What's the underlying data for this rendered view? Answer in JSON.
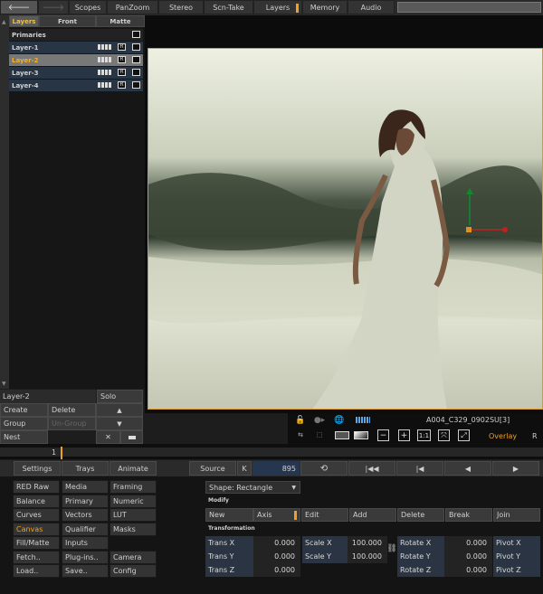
{
  "accent": "#f0a020",
  "topbar": {
    "back_icon": "back-arrow-icon",
    "forward_icon": "forward-arrow-icon",
    "tabs": [
      "Scopes",
      "PanZoom",
      "Stereo",
      "Scn-Take",
      "Layers",
      "Memory",
      "Audio"
    ],
    "active": "Layers"
  },
  "layer_tabs": [
    "Layers",
    "Front",
    "Matte"
  ],
  "layers": {
    "group": "Primaries",
    "items": [
      {
        "name": "Layer-1",
        "r": "R"
      },
      {
        "name": "Layer-2",
        "r": "R"
      },
      {
        "name": "Layer-3",
        "r": "R"
      },
      {
        "name": "Layer-4",
        "r": "R"
      }
    ],
    "selected": "Layer-2"
  },
  "layer_panel": {
    "current": "Layer-2",
    "solo": "Solo",
    "create": "Create",
    "delete": "Delete",
    "group": "Group",
    "ungroup": "Un-Group",
    "nest": "Nest",
    "close": "✕",
    "up": "▲",
    "down": "▼"
  },
  "viewer": {
    "clip_name": "A004_C329_0902SU[3]",
    "overlay": "Overlay",
    "r": "R",
    "one_to_one": "1:1"
  },
  "timeline": {
    "frame": "1"
  },
  "transport": {
    "settings": "Settings",
    "trays": "Trays",
    "animate": "Animate",
    "source": "Source",
    "k": "K",
    "frame": "895"
  },
  "menu": [
    [
      "RED Raw",
      "Media",
      "Framing"
    ],
    [
      "Balance",
      "Primary",
      "Numeric"
    ],
    [
      "Curves",
      "Vectors",
      "LUT"
    ],
    [
      "Canvas",
      "Qualifier",
      "Masks"
    ],
    [
      "Fill/Matte",
      "Inputs",
      ""
    ],
    [
      "Fetch..",
      "Plug-ins..",
      "Camera"
    ],
    [
      "Load..",
      "Save..",
      "Config"
    ]
  ],
  "menu_active": "Canvas",
  "shape": {
    "select": "Shape: Rectangle",
    "modify": "Modify",
    "row": [
      "New",
      "Axis",
      "Edit",
      "Add",
      "Delete",
      "Break",
      "Join"
    ]
  },
  "transformation": {
    "title": "Transformation",
    "trans_x": {
      "label": "Trans X",
      "value": "0.000"
    },
    "trans_y": {
      "label": "Trans Y",
      "value": "0.000"
    },
    "trans_z": {
      "label": "Trans Z",
      "value": "0.000"
    },
    "scale_x": {
      "label": "Scale X",
      "value": "100.000"
    },
    "scale_y": {
      "label": "Scale Y",
      "value": "100.000"
    },
    "rotate_x": {
      "label": "Rotate X",
      "value": "0.000"
    },
    "rotate_y": {
      "label": "Rotate Y",
      "value": "0.000"
    },
    "rotate_z": {
      "label": "Rotate Z",
      "value": "0.000"
    },
    "pivot_x": "Pivot X",
    "pivot_y": "Pivot Y",
    "pivot_z": "Pivot Z"
  }
}
